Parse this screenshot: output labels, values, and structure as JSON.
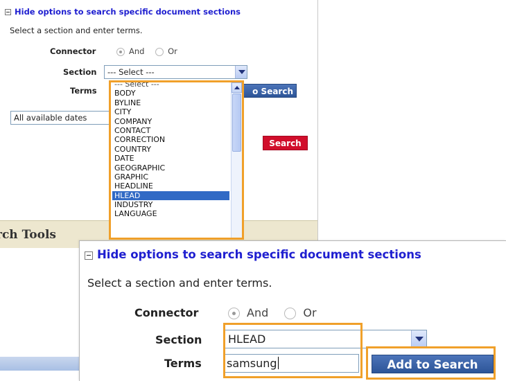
{
  "back_panel": {
    "header": "Hide options to search specific document sections",
    "subtitle": "Select a section and enter terms.",
    "connector_label": "Connector",
    "connector_and": "And",
    "connector_or": "Or",
    "section_label": "Section",
    "section_value": "--- Select ---",
    "terms_label": "Terms",
    "add_button_partial": "o Search",
    "dates_value": "All available dates",
    "search_button": "Search",
    "tools_partial": "rch Tools",
    "dropdown_items": [
      "--- Select ---",
      "BODY",
      "BYLINE",
      "CITY",
      "COMPANY",
      "CONTACT",
      "CORRECTION",
      "COUNTRY",
      "DATE",
      "GEOGRAPHIC",
      "GRAPHIC",
      "HEADLINE",
      "HLEAD",
      "INDUSTRY",
      "LANGUAGE"
    ],
    "dropdown_selected": "HLEAD"
  },
  "front_panel": {
    "header": "Hide options to search specific document sections",
    "subtitle": "Select a section and enter terms.",
    "connector_label": "Connector",
    "connector_and": "And",
    "connector_or": "Or",
    "section_label": "Section",
    "section_value": "HLEAD",
    "terms_label": "Terms",
    "terms_value": "samsung",
    "add_button": "Add to Search"
  },
  "colors": {
    "highlight": "#f0a02a",
    "link_blue": "#1f1fd0",
    "button_blue": "#2d5598",
    "search_red": "#d10e2b",
    "selection_blue": "#316ac5"
  }
}
